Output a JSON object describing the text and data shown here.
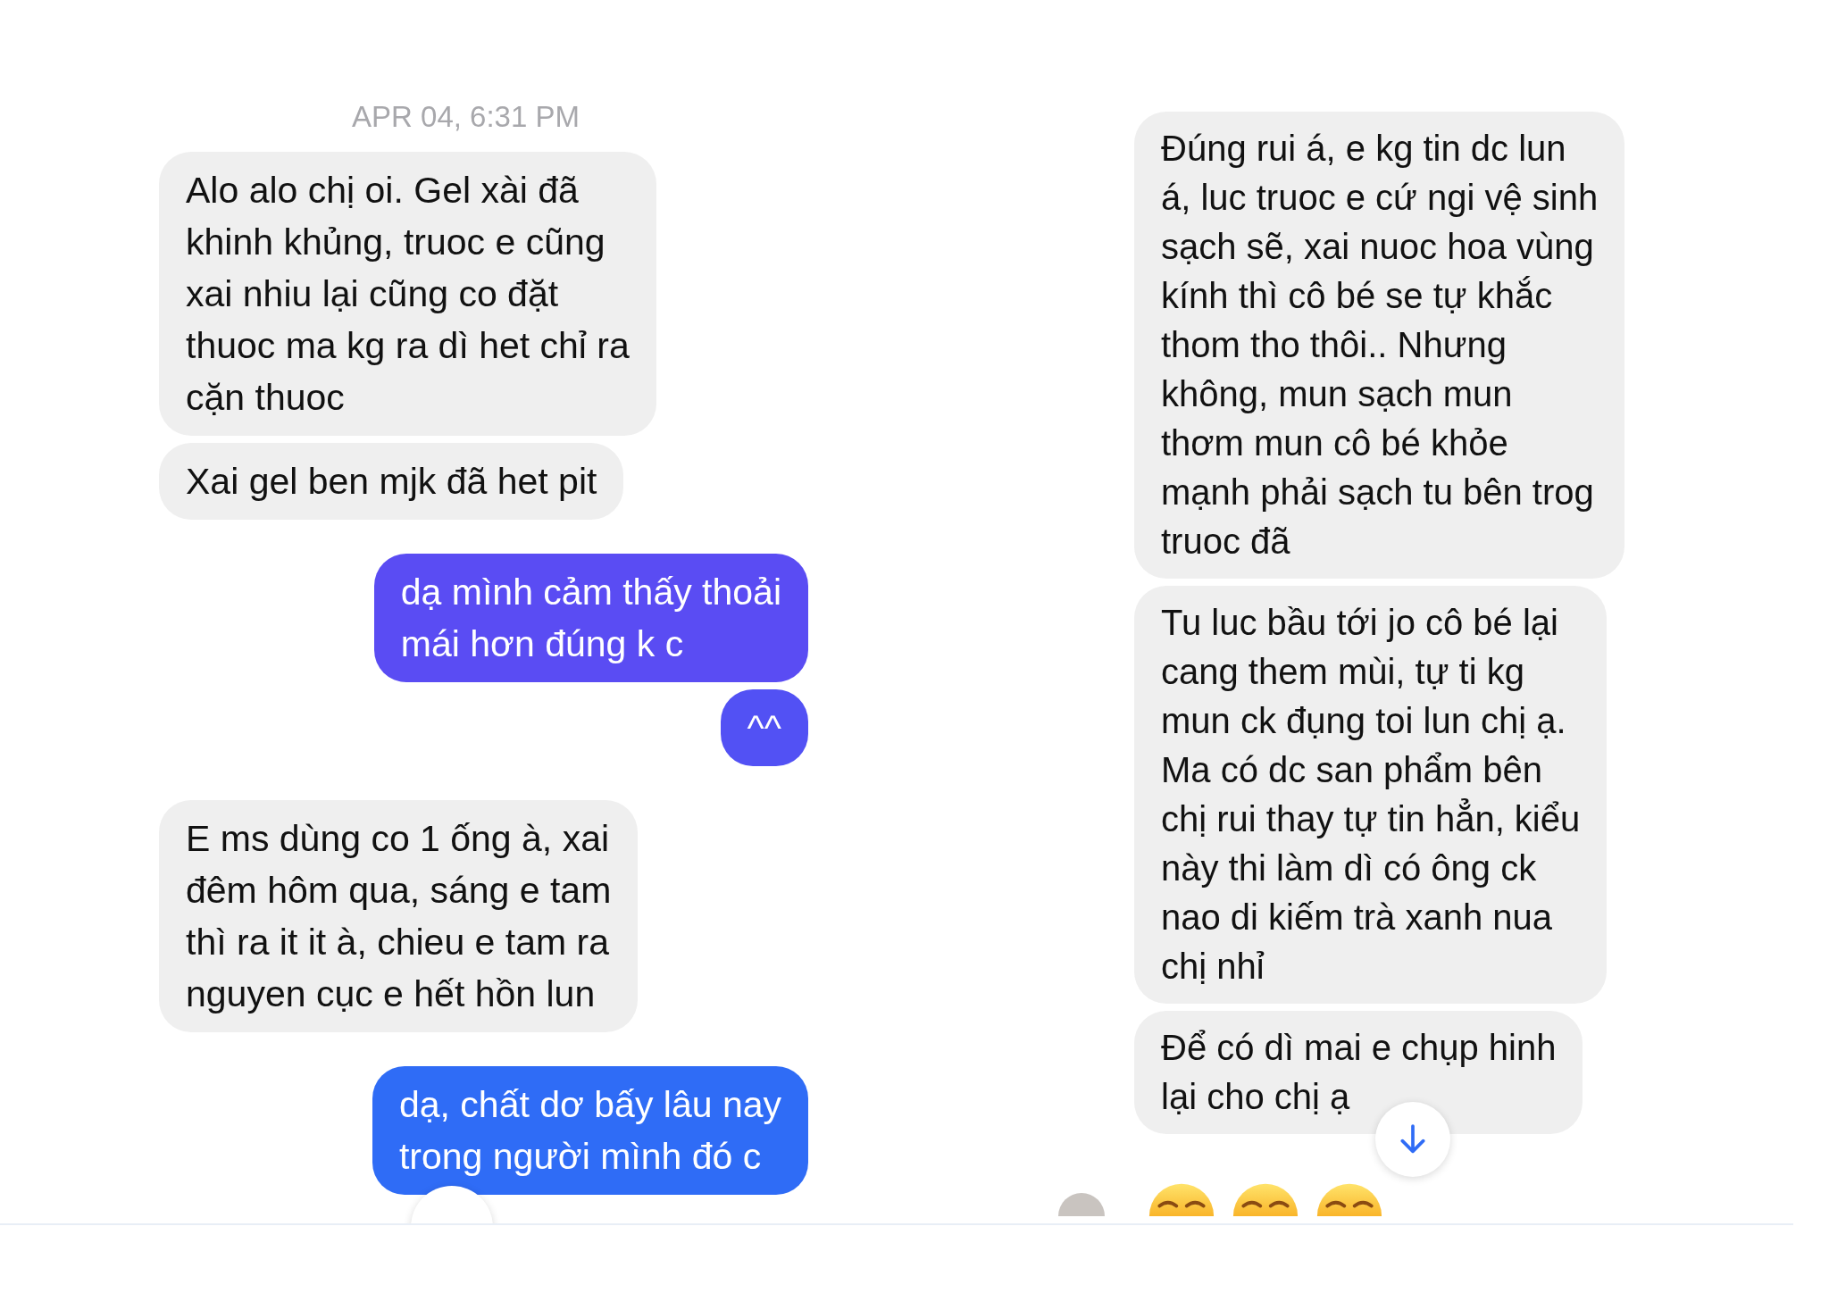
{
  "left_chat": {
    "timestamp": "APR 04, 6:31 PM",
    "messages": [
      {
        "kind": "received",
        "text": "Alo alo chị oi. Gel xài đã\nkhinh khủng, truoc e cũng\nxai nhiu lại cũng co đặt\nthuoc ma kg ra dì het chỉ ra\ncặn thuoc"
      },
      {
        "kind": "received",
        "text": "Xai gel ben mjk đã het pit"
      },
      {
        "kind": "sent",
        "color": "#5a4cf3",
        "text": "dạ mình cảm thấy thoải\nmái hơn đúng k c"
      },
      {
        "kind": "sent",
        "color": "#5251f4",
        "text": "^^"
      },
      {
        "kind": "received",
        "text": "E ms dùng co 1 ống à, xai\nđêm hôm qua, sáng e tam\nthì ra it it à, chieu e tam ra\nnguyen cục e hết hồn lun"
      },
      {
        "kind": "sent",
        "color": "#2f6cf6",
        "text": "dạ, chất dơ bấy lâu nay\ntrong người mình đó c"
      }
    ]
  },
  "right_chat": {
    "messages": [
      {
        "kind": "received",
        "text": "Đúng rui á, e kg tin dc lun\ná, luc truoc e cứ ngi vệ sinh\nsạch sẽ, xai nuoc hoa vùng\nkính thì cô bé se tự khắc\nthom tho thôi.. Nhưng\nkhông, mun sạch mun\nthơm mun cô bé khỏe\nmạnh phải sạch tu bên trog\ntruoc đã"
      },
      {
        "kind": "received",
        "text": "Tu luc bầu tới jo cô bé lại\ncang them mùi, tự ti kg\nmun ck đụng toi lun chị ạ.\nMa có dc san phẩm bên\nchị rui thay tự tin hẳn, kiểu\nnày thi làm dì có ông ck\nnao di kiếm trà xanh nua\nchị nhỉ"
      },
      {
        "kind": "received",
        "text": "Để có dì mai e chụp hinh\nlại cho chị ạ"
      }
    ]
  }
}
